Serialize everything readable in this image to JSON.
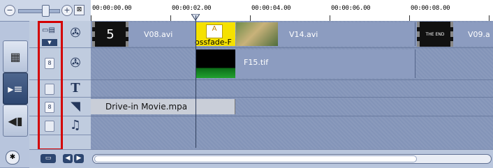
{
  "ruler": {
    "time_labels": [
      "00:00:00.00",
      "00:00:02.00",
      "00:00:04.00",
      "00:00:06.00",
      "00:00:08.00"
    ]
  },
  "zoom": {
    "minus": "−",
    "plus": "+"
  },
  "video_track": {
    "clips": [
      {
        "label": "V08.avi"
      },
      {
        "label": "ossfade-F"
      },
      {
        "label": "V14.avi"
      },
      {
        "label": "V09.a"
      }
    ],
    "thumb_text": "5"
  },
  "overlay_track": {
    "clips": [
      {
        "label": "F15.tif"
      }
    ]
  },
  "audio_track": {
    "clips": [
      {
        "label": "Drive-in Movie.mpa"
      }
    ]
  },
  "track_icons": [
    "film-reel-icon",
    "film-reel-icon",
    "title-t-icon",
    "voice-icon",
    "music-note-icon"
  ],
  "title_icon_text": "T",
  "music_icon_text": "♫",
  "lock_glyph": "8",
  "colors": {
    "highlight": "#d40000",
    "active_mode": "#2d4670"
  }
}
